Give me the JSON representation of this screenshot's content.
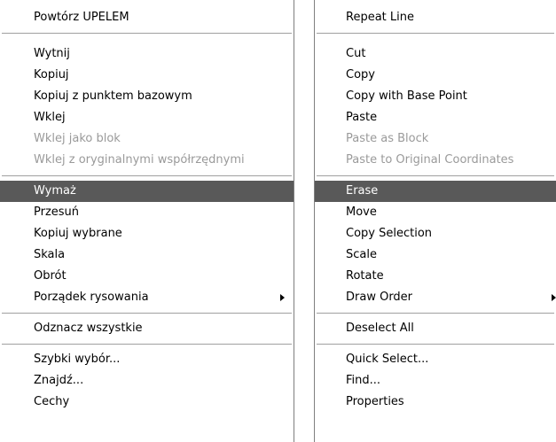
{
  "left_menu": {
    "repeat": "Powtórz UPELEM",
    "cut": "Wytnij",
    "copy": "Kopiuj",
    "copy_base_point": "Kopiuj z punktem bazowym",
    "paste": "Wklej",
    "paste_block": "Wklej jako blok",
    "paste_original": "Wklej z oryginalnymi współrzędnymi",
    "erase": "Wymaż",
    "move": "Przesuń",
    "copy_selection": "Kopiuj wybrane",
    "scale": "Skala",
    "rotate": "Obrót",
    "draw_order": "Porządek rysowania",
    "deselect_all": "Odznacz wszystkie",
    "quick_select": "Szybki wybór...",
    "find": "Znajdź...",
    "properties": "Cechy"
  },
  "right_menu": {
    "repeat": "Repeat Line",
    "cut": "Cut",
    "copy": "Copy",
    "copy_base_point": "Copy with Base Point",
    "paste": "Paste",
    "paste_block": "Paste as Block",
    "paste_original": "Paste to Original Coordinates",
    "erase": "Erase",
    "move": "Move",
    "copy_selection": "Copy Selection",
    "scale": "Scale",
    "rotate": "Rotate",
    "draw_order": "Draw Order",
    "deselect_all": "Deselect All",
    "quick_select": "Quick Select...",
    "find": "Find...",
    "properties": "Properties"
  },
  "colors": {
    "highlight_bg": "#595959",
    "highlight_text": "#ffffff",
    "disabled_text": "#9a9a9a",
    "separator": "#a0a0a0"
  }
}
